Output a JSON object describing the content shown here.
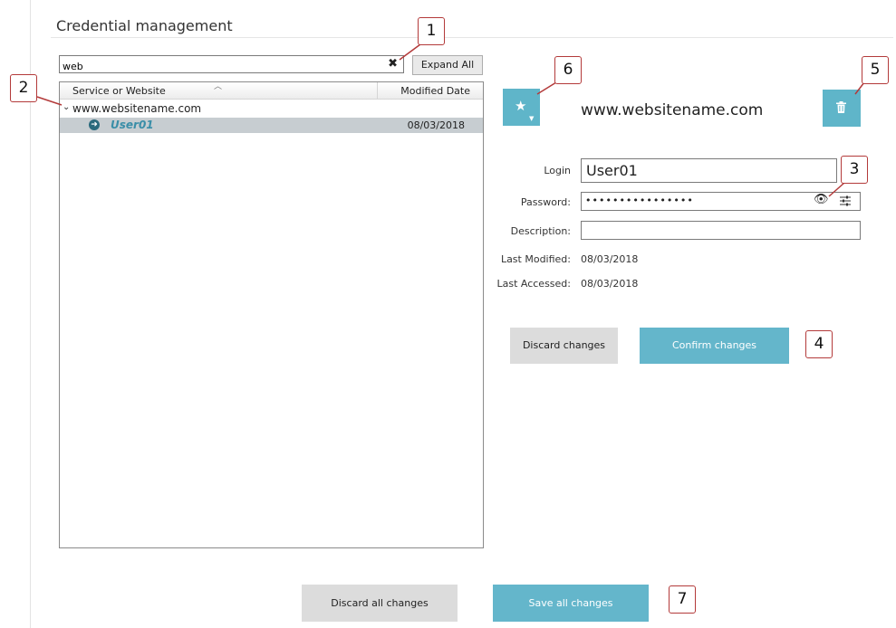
{
  "page": {
    "title": "Credential management"
  },
  "search": {
    "value": "web",
    "clear_icon": "close-icon"
  },
  "toolbar": {
    "expand_all_label": "Expand All"
  },
  "tree": {
    "columns": {
      "service": "Service or Website",
      "modified": "Modified Date"
    },
    "group": {
      "label": "www.websitename.com"
    },
    "child": {
      "label": "User01",
      "date": "08/03/2018"
    }
  },
  "detail": {
    "site_title": "www.websitename.com",
    "login_label": "Login",
    "login_value": "User01",
    "password_label": "Password:",
    "password_value": "••••••••••••••••",
    "description_label": "Description:",
    "description_value": "",
    "last_modified_label": "Last Modified:",
    "last_modified_value": "08/03/2018",
    "last_accessed_label": "Last Accessed:",
    "last_accessed_value": "08/03/2018",
    "discard_label": "Discard changes",
    "confirm_label": "Confirm changes"
  },
  "footer": {
    "discard_all_label": "Discard all changes",
    "save_all_label": "Save all changes"
  },
  "callouts": {
    "c1": "1",
    "c2": "2",
    "c3": "3",
    "c4": "4",
    "c5": "5",
    "c6": "6",
    "c7": "7"
  },
  "colors": {
    "accent": "#5fb5c9",
    "callout_border": "#b33a3a",
    "selected_row": "#c7cdd1",
    "child_text": "#3a8ea8"
  }
}
